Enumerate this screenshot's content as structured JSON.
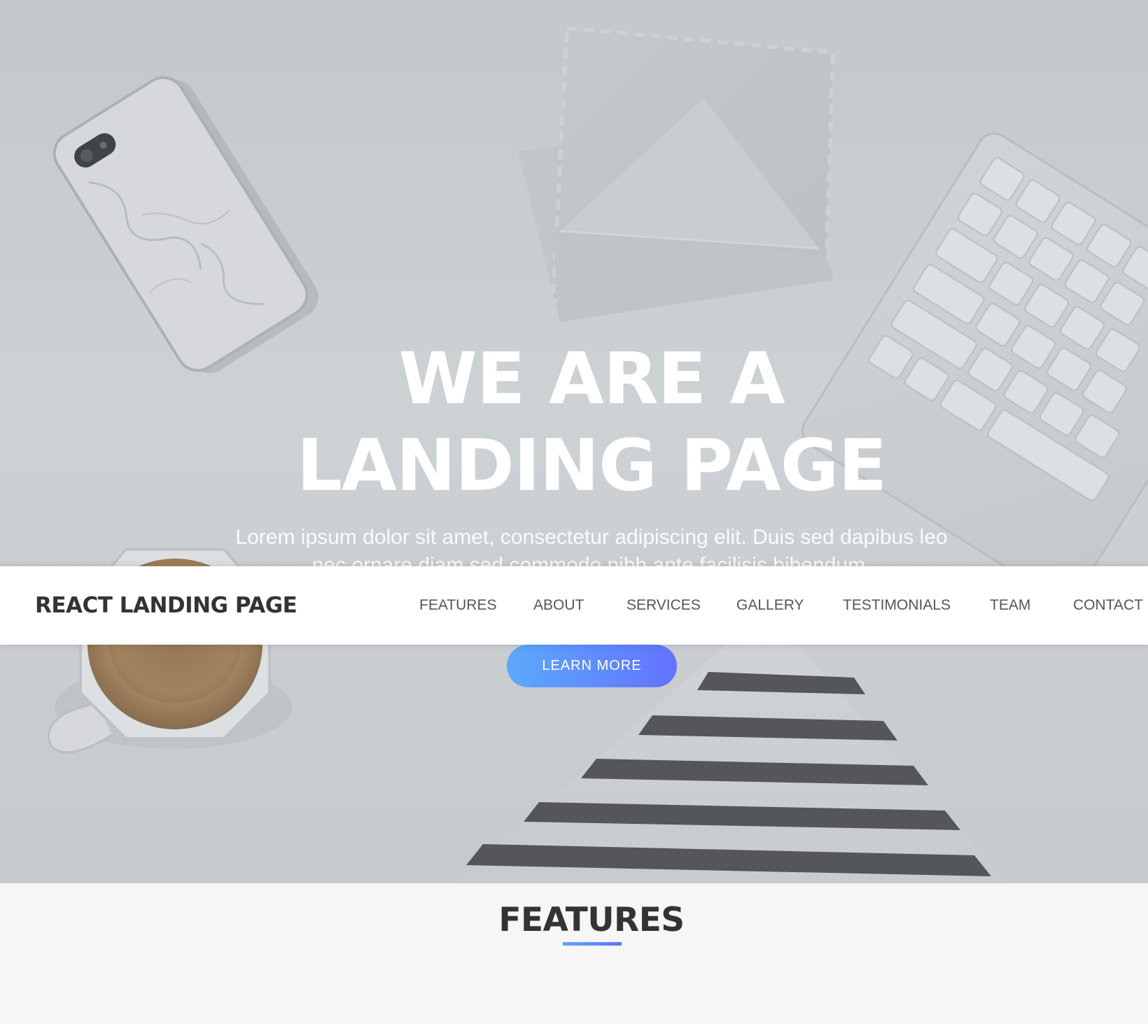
{
  "hero": {
    "title_line_1": "WE ARE A",
    "title_line_2": "LANDING PAGE",
    "paragraph": "Lorem ipsum dolor sit amet, consectetur adipiscing elit. Duis sed dapibus leo nec ornare diam sed commodo nibh ante facilisis bibendum.",
    "cta_label": "LEARN MORE"
  },
  "navbar": {
    "brand": "REACT LANDING PAGE",
    "links": [
      "FEATURES",
      "ABOUT",
      "SERVICES",
      "GALLERY",
      "TESTIMONIALS",
      "TEAM",
      "CONTACT"
    ]
  },
  "features": {
    "title": "FEATURES"
  },
  "colors": {
    "accent_start": "#5ca9fb",
    "accent_end": "#6372ff",
    "nav_text": "#555555",
    "heading_text": "#333333",
    "hero_text": "#ffffff"
  },
  "icons": {
    "hero_background": "desk-photo-phone-envelope-keyboard-coffee-striped-paper"
  }
}
